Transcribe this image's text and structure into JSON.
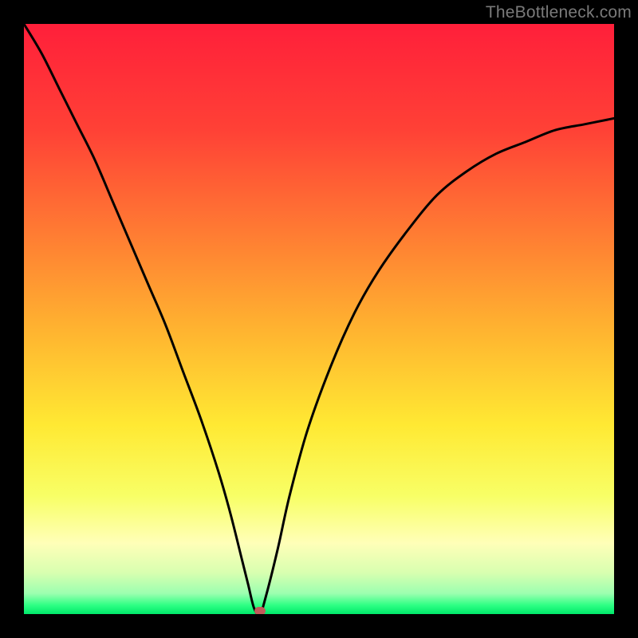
{
  "watermark": "TheBottleneck.com",
  "marker_color": "#c25a5a",
  "chart_data": {
    "type": "line",
    "title": "",
    "xlabel": "",
    "ylabel": "",
    "xlim": [
      0,
      100
    ],
    "ylim": [
      0,
      100
    ],
    "curve": {
      "x": [
        0,
        3,
        6,
        9,
        12,
        15,
        18,
        21,
        24,
        27,
        30,
        33,
        35,
        37,
        38,
        39,
        40,
        41,
        43,
        45,
        48,
        52,
        56,
        60,
        65,
        70,
        75,
        80,
        85,
        90,
        95,
        100
      ],
      "y": [
        100,
        95,
        89,
        83,
        77,
        70,
        63,
        56,
        49,
        41,
        33,
        24,
        17,
        9,
        5,
        1,
        0,
        3,
        11,
        20,
        31,
        42,
        51,
        58,
        65,
        71,
        75,
        78,
        80,
        82,
        83,
        84
      ]
    },
    "marker": {
      "x": 40,
      "y": 0.5
    },
    "gradient_stops": [
      {
        "pct": 0,
        "color": "#ff1f3a"
      },
      {
        "pct": 18,
        "color": "#ff4136"
      },
      {
        "pct": 35,
        "color": "#ff7a33"
      },
      {
        "pct": 52,
        "color": "#ffb430"
      },
      {
        "pct": 68,
        "color": "#ffe933"
      },
      {
        "pct": 80,
        "color": "#f8ff66"
      },
      {
        "pct": 88,
        "color": "#ffffb8"
      },
      {
        "pct": 93,
        "color": "#d8ffb0"
      },
      {
        "pct": 96.5,
        "color": "#9cffb0"
      },
      {
        "pct": 98.5,
        "color": "#2eff84"
      },
      {
        "pct": 100,
        "color": "#00e86a"
      }
    ]
  }
}
